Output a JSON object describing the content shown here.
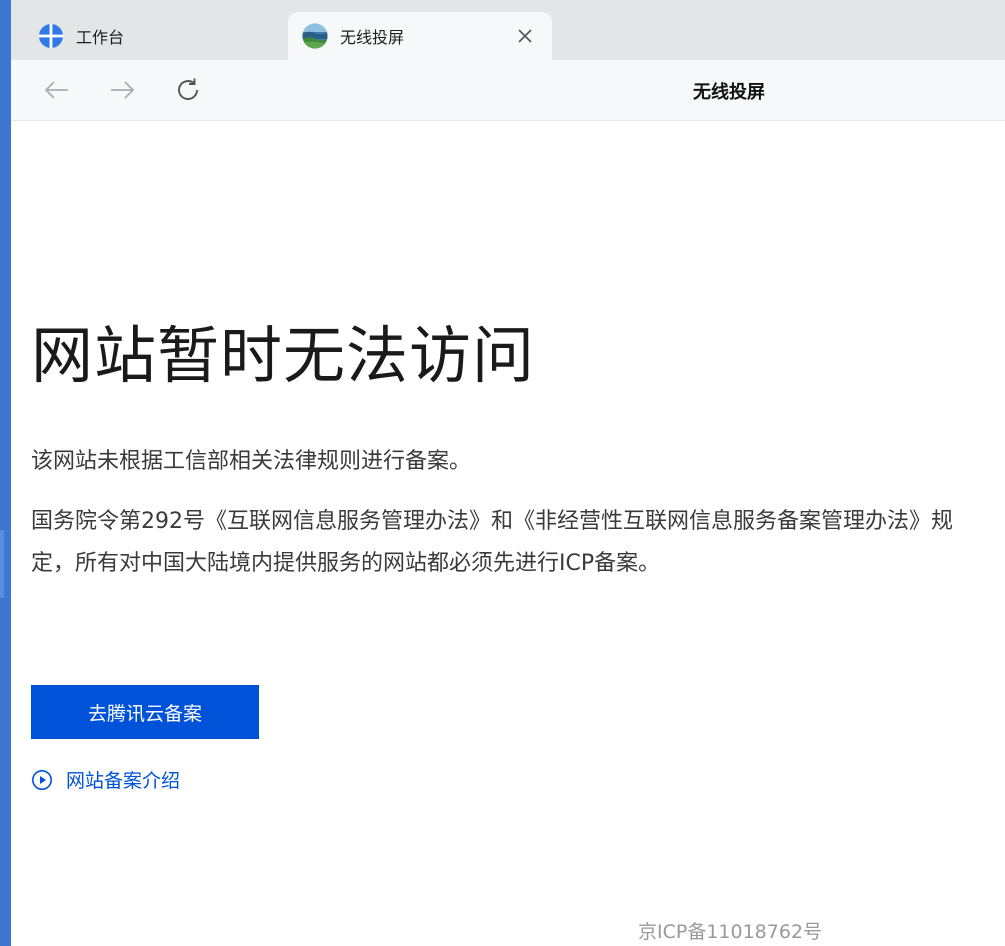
{
  "tabs": [
    {
      "label": "工作台",
      "icon": "workbench-icon",
      "active": false
    },
    {
      "label": "无线投屏",
      "icon": "landscape-favicon",
      "active": true
    }
  ],
  "toolbar": {
    "title": "无线投屏",
    "back_icon": "arrow-left-icon",
    "forward_icon": "arrow-right-icon",
    "reload_icon": "reload-icon"
  },
  "main": {
    "title": "网站暂时无法访问",
    "description_1": "该网站未根据工信部相关法律规则进行备案。",
    "description_2": "国务院令第292号《互联网信息服务管理办法》和《非经营性互联网信息服务备案管理办法》规定，所有对中国大陆境内提供服务的网站都必须先进行ICP备案。",
    "primary_button": "去腾讯云备案",
    "intro_link": "网站备案介绍"
  },
  "footer": {
    "icp": "京ICP备11018762号"
  },
  "colors": {
    "accent": "#0052d9",
    "left_bar": "#3c78d0",
    "workbench_icon": "#2f7ae5"
  }
}
